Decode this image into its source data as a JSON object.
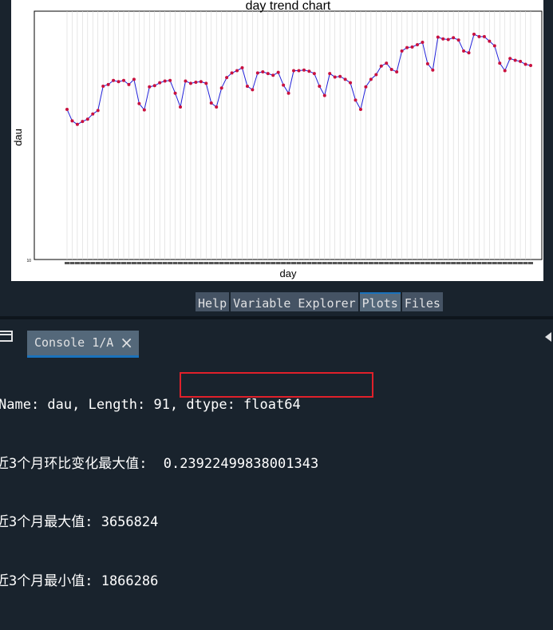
{
  "plot": {
    "title": "day trend chart",
    "xlabel": "day",
    "ylabel": "dau",
    "y_tick_label": "10"
  },
  "pane_tabs": [
    "Help",
    "Variable Explorer",
    "Plots",
    "Files"
  ],
  "active_pane_tab": "Plots",
  "console": {
    "tab_label": "Console 1/A",
    "close_icon": "×",
    "lines": [
      "Name: dau, Length: 91, dtype: float64",
      "近3个月环比变化最大值: ",
      "近3个月最大值: 3656824",
      "近3个月最小值: 1866286"
    ],
    "highlight_value": "0.23922499838001343"
  },
  "colors": {
    "line": "#1f1fd8",
    "marker": "#c8103e",
    "highlight_border": "#e0202a",
    "active_tab_accent": "#1a72bb"
  },
  "chart_data": {
    "type": "line",
    "title": "day trend chart",
    "xlabel": "day",
    "ylabel": "dau",
    "n_points": 91,
    "ylim": [
      10,
      4300000
    ],
    "grid": true,
    "y_visible_tick": "10",
    "values": [
      2600000,
      2400000,
      2340000,
      2390000,
      2430000,
      2520000,
      2580000,
      3000000,
      3030000,
      3100000,
      3080000,
      3100000,
      3030000,
      3120000,
      2700000,
      2590000,
      2990000,
      3010000,
      3060000,
      3090000,
      3100000,
      2880000,
      2640000,
      3090000,
      3050000,
      3070000,
      3080000,
      3050000,
      2710000,
      2640000,
      2970000,
      3150000,
      3230000,
      3270000,
      3320000,
      3000000,
      2940000,
      3230000,
      3250000,
      3220000,
      3190000,
      3240000,
      3020000,
      2880000,
      3270000,
      3270000,
      3280000,
      3260000,
      3220000,
      3000000,
      2840000,
      3220000,
      3160000,
      3170000,
      3120000,
      3060000,
      2760000,
      2600000,
      2990000,
      3120000,
      3200000,
      3350000,
      3400000,
      3290000,
      3250000,
      3610000,
      3670000,
      3680000,
      3720000,
      3760000,
      3390000,
      3280000,
      3850000,
      3820000,
      3810000,
      3840000,
      3800000,
      3610000,
      3580000,
      3900000,
      3860000,
      3860000,
      3780000,
      3700000,
      3400000,
      3270000,
      3480000,
      3450000,
      3430000,
      3380000,
      3360000
    ]
  }
}
